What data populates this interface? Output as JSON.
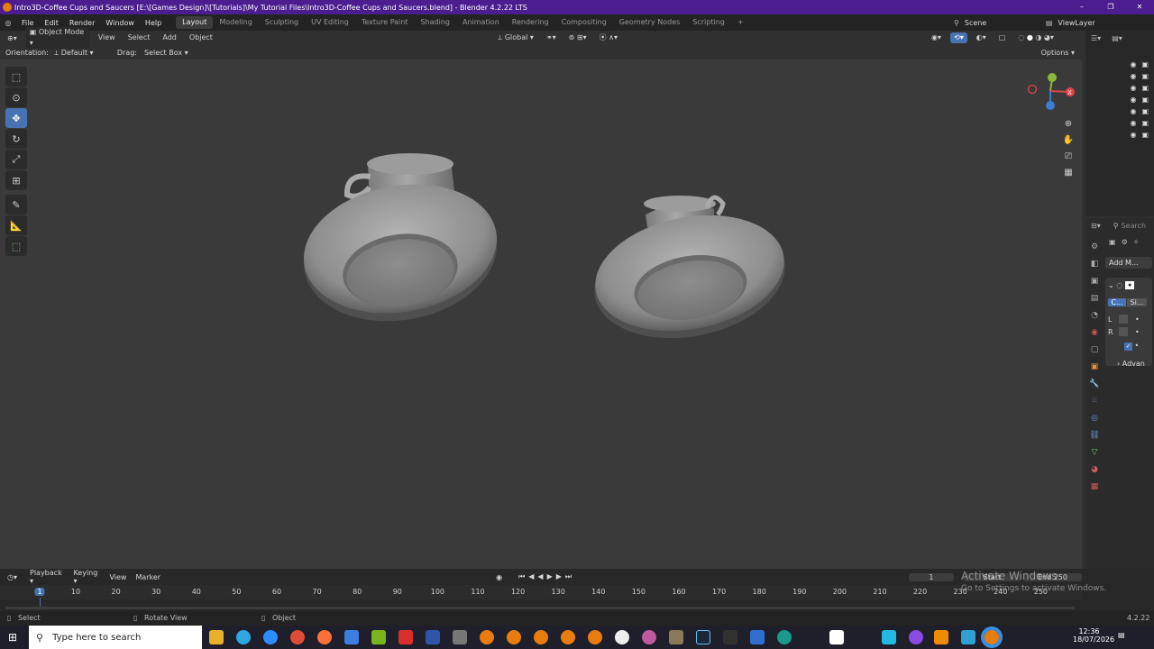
{
  "title_bar": {
    "title": "Intro3D-Coffee Cups and Saucers [E:\\[Games Design]\\[Tutorials]\\My Tutorial Files\\Intro3D-Coffee Cups and Saucers.blend] - Blender 4.2.22 LTS",
    "minimize": "–",
    "maximize": "❐",
    "close": "✕"
  },
  "menu": {
    "file": "File",
    "edit": "Edit",
    "render": "Render",
    "window": "Window",
    "help": "Help"
  },
  "workspaces": [
    "Layout",
    "Modeling",
    "Sculpting",
    "UV Editing",
    "Texture Paint",
    "Shading",
    "Animation",
    "Rendering",
    "Compositing",
    "Geometry Nodes",
    "Scripting"
  ],
  "add_workspace": "+",
  "scene": {
    "label": "Scene",
    "view_layer": "ViewLayer"
  },
  "viewport_header": {
    "mode": "Object Mode",
    "view": "View",
    "select": "Select",
    "add": "Add",
    "object": "Object",
    "transform_orientation": "Global"
  },
  "tool_settings": {
    "orientation_label": "Orientation:",
    "orientation_value": "Default",
    "drag_label": "Drag:",
    "drag_value": "Select Box",
    "options": "Options"
  },
  "gizmo": {
    "x": "X",
    "y": "Y",
    "z": "Z"
  },
  "properties": {
    "search_placeholder": "Search",
    "add_modifier": "Add M...",
    "btn_c": "C...",
    "btn_s": "Si...",
    "row_l": "L",
    "row_r": "R",
    "advanced": "Advan"
  },
  "timeline": {
    "playback": "Playback",
    "keying": "Keying",
    "view": "View",
    "marker": "Marker",
    "current_frame": "1",
    "start_label": "Start",
    "end_label": "End",
    "end_value": "250",
    "ruler": [
      "1",
      "10",
      "20",
      "30",
      "40",
      "50",
      "60",
      "70",
      "80",
      "90",
      "100",
      "110",
      "120",
      "130",
      "140",
      "150",
      "160",
      "170",
      "180",
      "190",
      "200",
      "210",
      "220",
      "230",
      "240",
      "250"
    ]
  },
  "watermark": {
    "line1": "Activate Windows",
    "line2": "Go to Settings to activate Windows."
  },
  "status": {
    "select": "Select",
    "rotate": "Rotate View",
    "object": "Object",
    "version": "4.2.22"
  },
  "taskbar": {
    "search_placeholder": "Type here to search",
    "time": "12:36",
    "date": "18/07/2026"
  }
}
